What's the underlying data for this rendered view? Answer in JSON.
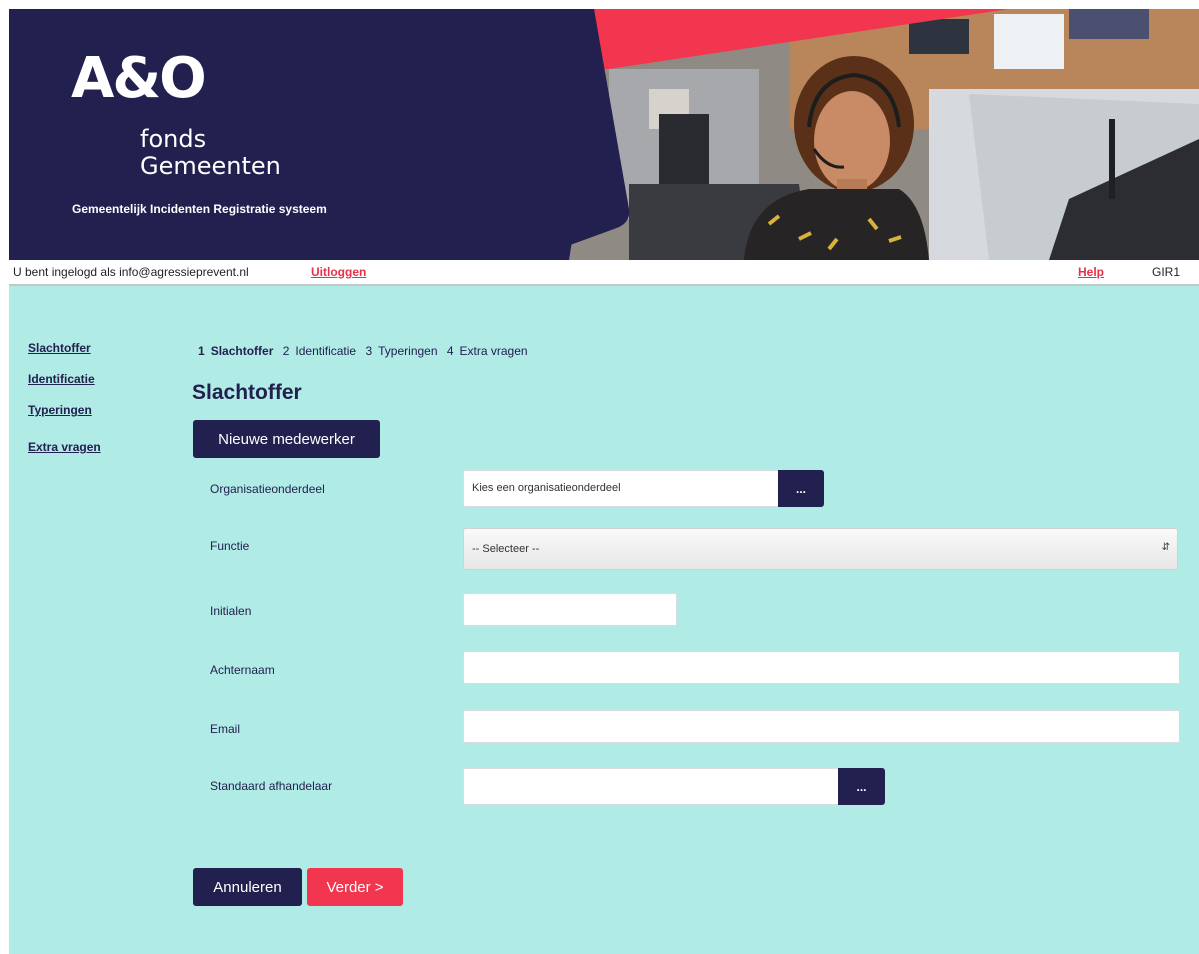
{
  "banner": {
    "logo": "A&O",
    "logo_line1": "fonds",
    "logo_line2": "Gemeenten",
    "subtitle": "Gemeentelijk Incidenten Registratie systeem"
  },
  "loginbar": {
    "text": "U bent ingelogd als info@agressieprevent.nl",
    "logout": "Uitloggen",
    "help": "Help",
    "code": "GIR1"
  },
  "sidebar": {
    "items": [
      {
        "label": "Slachtoffer"
      },
      {
        "label": "Identificatie"
      },
      {
        "label": "Typeringen"
      },
      {
        "label": "Extra vragen"
      }
    ]
  },
  "steps": [
    {
      "num": "1",
      "label": "Slachtoffer",
      "active": true
    },
    {
      "num": "2",
      "label": "Identificatie"
    },
    {
      "num": "3",
      "label": "Typeringen"
    },
    {
      "num": "4",
      "label": "Extra vragen"
    }
  ],
  "page": {
    "title": "Slachtoffer",
    "new_employee_button": "Nieuwe medewerker"
  },
  "form": {
    "organisatie": {
      "label": "Organisatieonderdeel",
      "value": "Kies een organisatieonderdeel",
      "button": "..."
    },
    "functie": {
      "label": "Functie",
      "value": "-- Selecteer --"
    },
    "initialen": {
      "label": "Initialen",
      "value": ""
    },
    "achternaam": {
      "label": "Achternaam",
      "value": ""
    },
    "email": {
      "label": "Email",
      "value": ""
    },
    "afhandelaar": {
      "label": "Standaard afhandelaar",
      "value": "",
      "button": "..."
    }
  },
  "actions": {
    "cancel": "Annuleren",
    "next": "Verder >"
  },
  "colors": {
    "navy": "#22204f",
    "red": "#f2364f",
    "background": "#b1ebe6"
  }
}
